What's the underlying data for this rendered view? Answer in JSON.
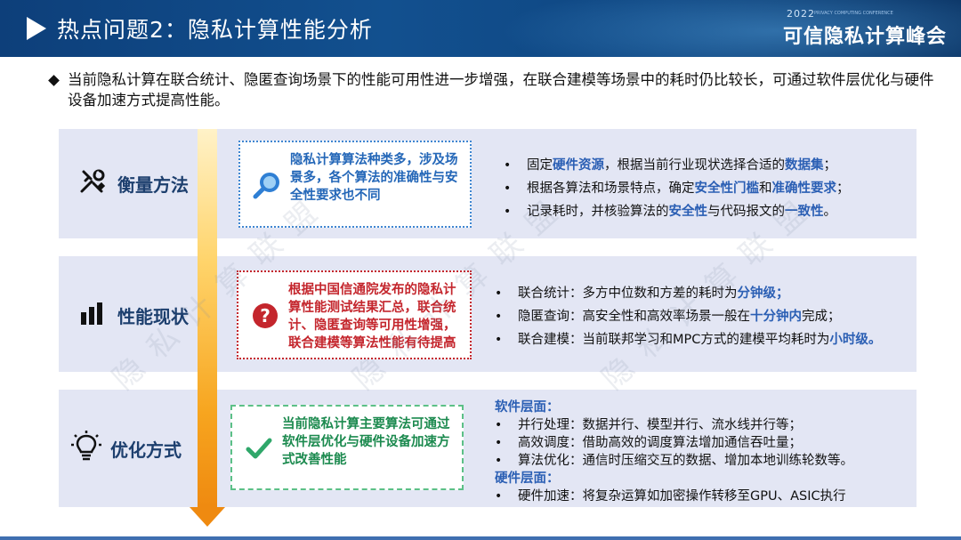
{
  "header": {
    "title": "热点问题2：隐私计算性能分析",
    "brand_year": "2022",
    "brand_sub": "PRIVACY COMPUTING CONFERENCE",
    "brand_name": "可信隐私计算峰会"
  },
  "intro": "当前隐私计算在联合统计、隐匿查询场景下的性能可用性进一步增强，在联合建模等场景中的耗时仍比较长，可通过软件层优化与硬件设备加速方式提高性能。",
  "sections": [
    {
      "label": "衡量方法",
      "icon": "tools-icon",
      "note": "隐私计算算法种类多，涉及场景多，各个算法的准确性与安全性要求也不同",
      "note_icon": "search-icon",
      "items": [
        [
          "固定",
          "硬件资源",
          "，根据当前行业现状选择合适的",
          "数据集",
          "；"
        ],
        [
          "根据各算法和场景特点，确定",
          "安全性门槛",
          "和",
          "准确性要求",
          "；"
        ],
        [
          "记录耗时，并核验算法的",
          "安全性",
          "与代码报文的",
          "一致性",
          "。"
        ]
      ]
    },
    {
      "label": "性能现状",
      "icon": "bar-chart-icon",
      "note": "根据中国信通院发布的隐私计算性能测试结果汇总，联合统计、隐匿查询等可用性增强，联合建模等算法性能有待提高",
      "note_icon": "question-icon",
      "items": [
        [
          "联合统计：多方中位数和方差的耗时为",
          "分钟级；",
          "",
          "",
          ""
        ],
        [
          "隐匿查询：高安全性和高效率场景一般在",
          "十分钟内",
          "完成；",
          "",
          ""
        ],
        [
          "联合建模：当前联邦学习和MPC方式的建模平均耗时为",
          "小时级。",
          "",
          "",
          ""
        ]
      ]
    },
    {
      "label": "优化方式",
      "icon": "lightbulb-icon",
      "note": "当前隐私计算主要算法可通过软件层优化与硬件设备加速方式改善性能",
      "note_icon": "check-icon",
      "software_head": "软件层面：",
      "software_items": [
        "并行处理：数据并行、模型并行、流水线并行等；",
        "高效调度：借助高效的调度算法增加通信吞吐量；",
        "算法优化：通信时压缩交互的数据、增加本地训练轮数等。"
      ],
      "hardware_head": "硬件层面：",
      "hardware_items": [
        "硬件加速：将复杂运算如加密操作转移至GPU、ASIC执行"
      ]
    }
  ],
  "watermark": "隐私计算联盟"
}
